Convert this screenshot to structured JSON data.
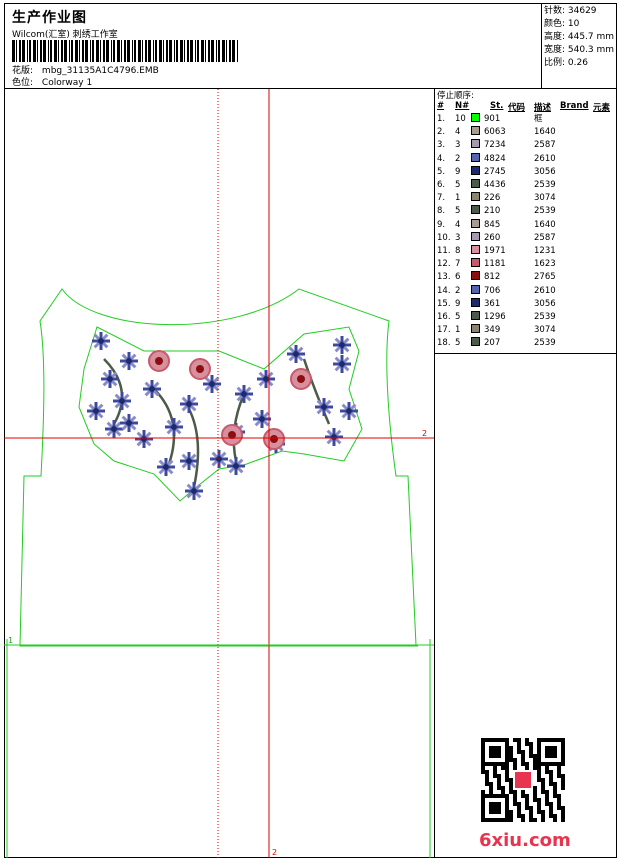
{
  "header": {
    "title": "生产作业图",
    "company": "Wilcom(汇室) 刺绣工作室",
    "design_label": "花版:",
    "design_value": "mbg_31135A1C4796.EMB",
    "colorway_label": "色位:",
    "colorway_value": "Colorway 1"
  },
  "stats": {
    "stitches": "针数: 34629",
    "colors": "颜色: 10",
    "height": "高度: 445.7 mm",
    "width": "宽度: 540.3 mm",
    "scale": "比例: 0.26"
  },
  "table": {
    "stop_sequence_label": "停止顺序:",
    "headers": [
      "#",
      "N#",
      "St.",
      "代码",
      "描述",
      "Brand",
      "元素"
    ],
    "rows": [
      {
        "idx": "1.",
        "n": "10",
        "color": "#00ff00",
        "code": "901",
        "desc": "框"
      },
      {
        "idx": "2.",
        "n": "4",
        "color": "#a79c8e",
        "code": "6063",
        "desc": "1640"
      },
      {
        "idx": "3.",
        "n": "3",
        "color": "#a69ab0",
        "code": "7234",
        "desc": "2587"
      },
      {
        "idx": "4.",
        "n": "2",
        "color": "#5664b0",
        "code": "4824",
        "desc": "2610"
      },
      {
        "idx": "5.",
        "n": "9",
        "color": "#1c2a6e",
        "code": "2745",
        "desc": "3056"
      },
      {
        "idx": "6.",
        "n": "5",
        "color": "#4c5a48",
        "code": "4436",
        "desc": "2539"
      },
      {
        "idx": "7.",
        "n": "1",
        "color": "#8c8270",
        "code": "226",
        "desc": "3074"
      },
      {
        "idx": "8.",
        "n": "5",
        "color": "#4c5a48",
        "code": "210",
        "desc": "2539"
      },
      {
        "idx": "9.",
        "n": "4",
        "color": "#a79c8e",
        "code": "845",
        "desc": "1640"
      },
      {
        "idx": "10.",
        "n": "3",
        "color": "#a69ab0",
        "code": "260",
        "desc": "2587"
      },
      {
        "idx": "11.",
        "n": "8",
        "color": "#d9909e",
        "code": "1971",
        "desc": "1231"
      },
      {
        "idx": "12.",
        "n": "7",
        "color": "#c85a6a",
        "code": "1181",
        "desc": "1623"
      },
      {
        "idx": "13.",
        "n": "6",
        "color": "#8a1010",
        "code": "812",
        "desc": "2765"
      },
      {
        "idx": "14.",
        "n": "2",
        "color": "#5664b0",
        "code": "706",
        "desc": "2610"
      },
      {
        "idx": "15.",
        "n": "9",
        "color": "#1c2a6e",
        "code": "361",
        "desc": "3056"
      },
      {
        "idx": "16.",
        "n": "5",
        "color": "#4c5a48",
        "code": "1296",
        "desc": "2539"
      },
      {
        "idx": "17.",
        "n": "1",
        "color": "#8c8270",
        "code": "349",
        "desc": "3074"
      },
      {
        "idx": "18.",
        "n": "5",
        "color": "#4c5a48",
        "code": "207",
        "desc": "2539"
      }
    ]
  },
  "guides": {
    "marker_right": "2",
    "marker_bottom": "2",
    "marker_left": "1"
  },
  "watermark": "6xiu.com"
}
